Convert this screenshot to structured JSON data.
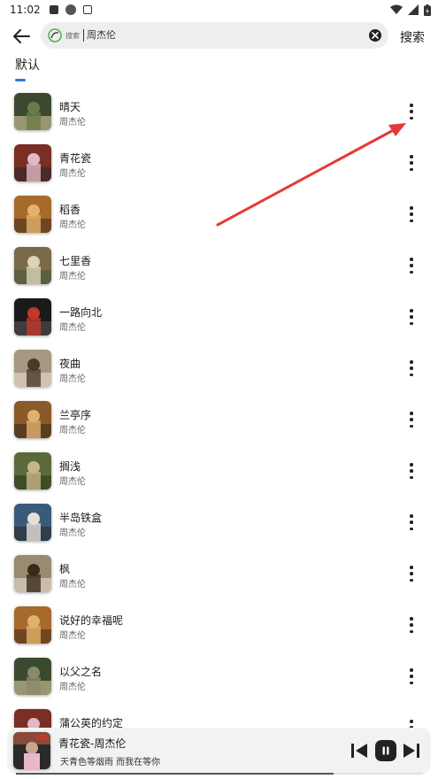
{
  "status_bar": {
    "time": "11:02"
  },
  "search": {
    "hint": "搜索",
    "query": "周杰伦",
    "button_label": "搜索"
  },
  "tabs": {
    "default_label": "默认"
  },
  "songs": [
    {
      "title": "晴天",
      "artist": "周杰伦"
    },
    {
      "title": "青花瓷",
      "artist": "周杰伦"
    },
    {
      "title": "稻香",
      "artist": "周杰伦"
    },
    {
      "title": "七里香",
      "artist": "周杰伦"
    },
    {
      "title": "一路向北",
      "artist": "周杰伦"
    },
    {
      "title": "夜曲",
      "artist": "周杰伦"
    },
    {
      "title": "兰亭序",
      "artist": "周杰伦"
    },
    {
      "title": "搁浅",
      "artist": "周杰伦"
    },
    {
      "title": "半岛铁盒",
      "artist": "周杰伦"
    },
    {
      "title": "枫",
      "artist": "周杰伦"
    },
    {
      "title": "说好的幸福呢",
      "artist": "周杰伦"
    },
    {
      "title": "以父之名",
      "artist": "周杰伦"
    },
    {
      "title": "蒲公英的约定",
      "artist": "周杰伦"
    }
  ],
  "player": {
    "title": "青花瓷-周杰伦",
    "lyric": "天青色等烟雨 而我在等你",
    "progress": 0.78
  },
  "colors": {
    "accent": "#2a7be4",
    "arrow": "#e53935"
  }
}
